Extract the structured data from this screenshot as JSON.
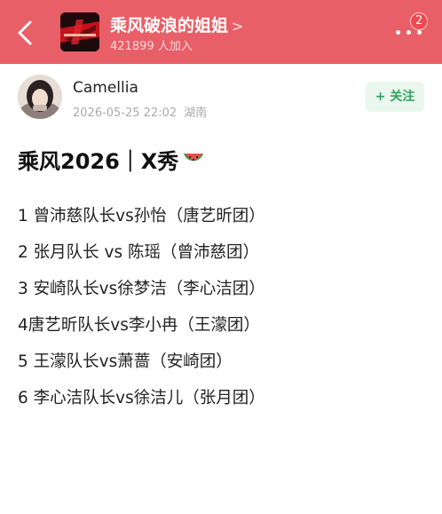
{
  "header": {
    "group_name": "乘风破浪的姐姐",
    "group_chevron": ">",
    "member_count": "421899",
    "member_suffix": "人加入",
    "notification_count": "2",
    "logo_text": "乘风破浪的姐姐",
    "theme_color": "#e95f67"
  },
  "post": {
    "author": "Camellia",
    "timestamp": "2026-05-25 22:02",
    "location": "湖南",
    "follow_label": "+ 关注",
    "title": "乘风2026｜X秀",
    "title_emoji": "watermelon-icon",
    "matchups": [
      "1 曾沛慈队长vs孙怡（唐艺昕团）",
      "2 张月队长 vs 陈瑶（曾沛慈团）",
      "3 安崎队长vs徐梦洁（李心洁团）",
      "4唐艺昕队长vs李小冉（王濛团）",
      "5 王濛队长vs萧蔷（安崎团）",
      "6 李心洁队长vs徐洁儿（张月团）"
    ]
  }
}
